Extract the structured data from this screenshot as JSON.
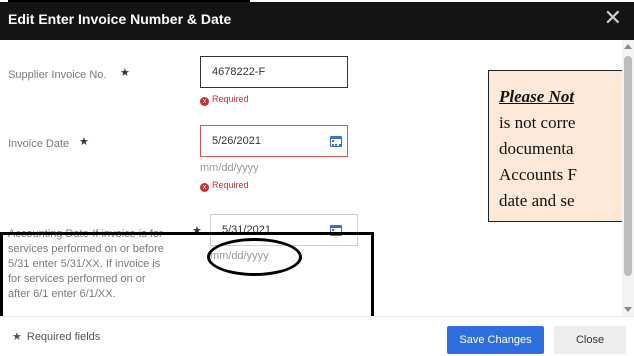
{
  "dialog": {
    "title": "Edit Enter Invoice Number & Date",
    "close_icon": "close-icon"
  },
  "fields": {
    "supplier_invoice": {
      "label": "Supplier Invoice No.",
      "value": "4678222-F",
      "error": "Required"
    },
    "invoice_date": {
      "label": "Invoice Date",
      "value": "5/26/2021",
      "format_hint": "mm/dd/yyyy",
      "error": "Required"
    },
    "accounting_date": {
      "label_lines": [
        "Accounting Date-If invoice is for",
        "services performed on or before",
        "5/31 enter 5/31/XX. If invoice is",
        "for services performed on or",
        "after 6/1 enter 6/1/XX."
      ],
      "value": "5/31/2021",
      "format_hint": "mm/dd/yyyy"
    },
    "required_star": "★",
    "error_icon": "x"
  },
  "callout": {
    "lines": [
      "Please Not",
      "is not corre",
      "documenta",
      "Accounts F",
      "date and se"
    ]
  },
  "footer": {
    "required_note": "Required fields",
    "star": "★",
    "save_label": "Save Changes",
    "close_label": "Close"
  },
  "colors": {
    "titlebar": "#141414",
    "primary_button": "#2e6fe0",
    "error": "#c9302c",
    "callout_bg": "#fde9d9"
  }
}
